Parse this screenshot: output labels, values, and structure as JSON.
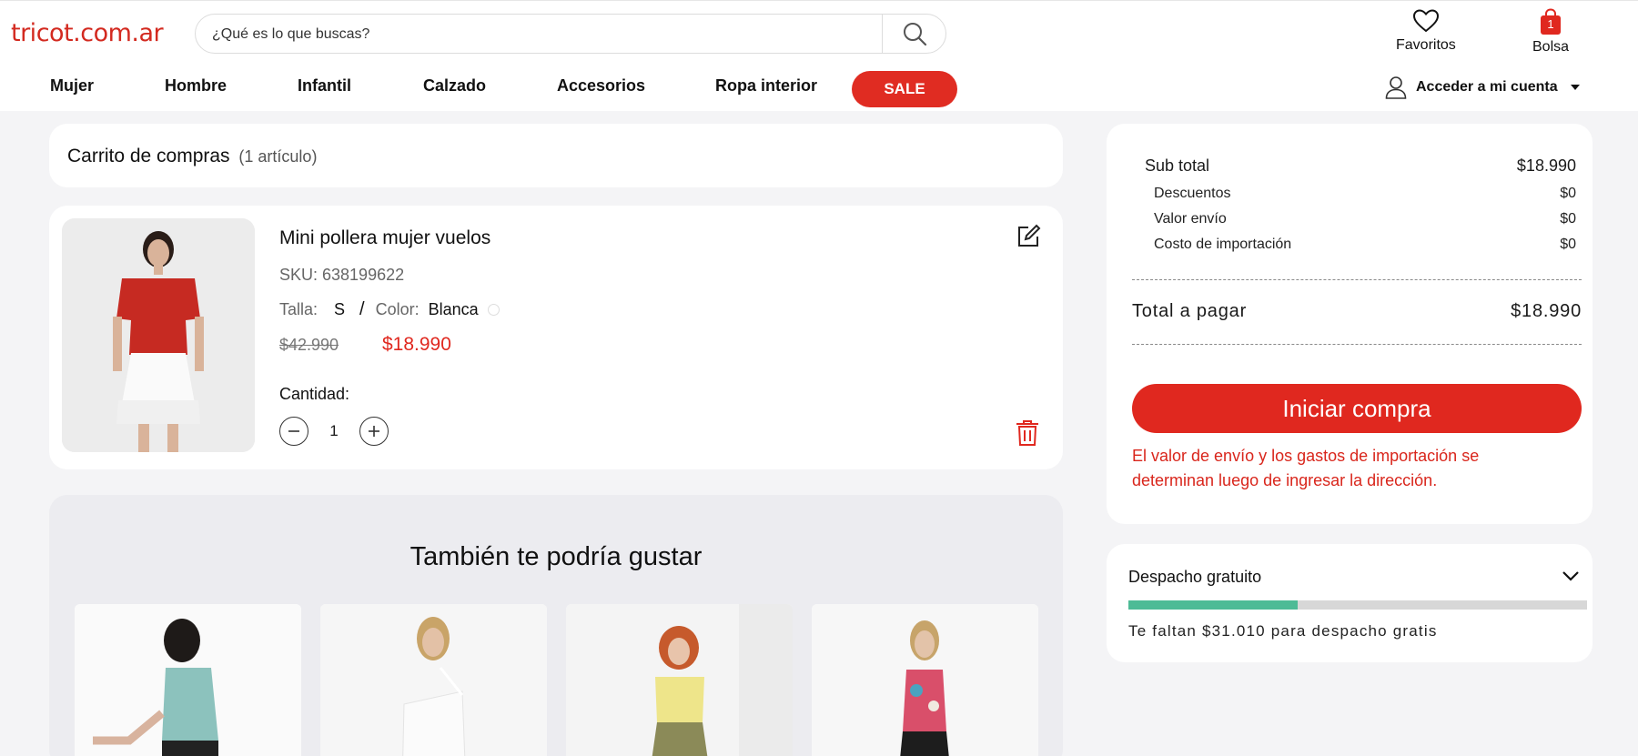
{
  "header": {
    "logo": "tricot.com.ar",
    "search": {
      "placeholder": "¿Qué es lo que buscas?"
    },
    "favorites_label": "Favoritos",
    "bag_label": "Bolsa",
    "bag_count": "1",
    "account_label": "Acceder a mi cuenta",
    "nav": [
      "Mujer",
      "Hombre",
      "Infantil",
      "Calzado",
      "Accesorios",
      "Ropa interior"
    ],
    "sale_label": "SALE"
  },
  "cart": {
    "title": "Carrito de compras",
    "count": "(1 artículo)",
    "item": {
      "name": "Mini pollera mujer vuelos",
      "sku": "SKU: 638199622",
      "size_label": "Talla:",
      "size": "S",
      "separator": "/",
      "color_label": "Color:",
      "color": "Blanca",
      "old_price": "$42.990",
      "price": "$18.990",
      "quantity_label": "Cantidad:",
      "quantity": "1"
    }
  },
  "recommendations": {
    "title": "También te podría gustar"
  },
  "summary": {
    "subtotal_label": "Sub total",
    "subtotal": "$18.990",
    "rows": [
      {
        "label": "Descuentos",
        "value": "$0"
      },
      {
        "label": "Valor envío",
        "value": "$0"
      },
      {
        "label": "Costo de importación",
        "value": "$0"
      }
    ],
    "total_label": "Total a pagar",
    "total": "$18.990",
    "cta": "Iniciar compra",
    "notice": "El valor de envío y los gastos de importación se determinan luego de ingresar la dirección."
  },
  "shipping": {
    "title": "Despacho gratuito",
    "progress_fraction": 0.37,
    "message": "Te faltan $31.010 para despacho gratis"
  },
  "colors": {
    "brand_red": "#e0281f",
    "progress_green": "#4dbb96"
  }
}
